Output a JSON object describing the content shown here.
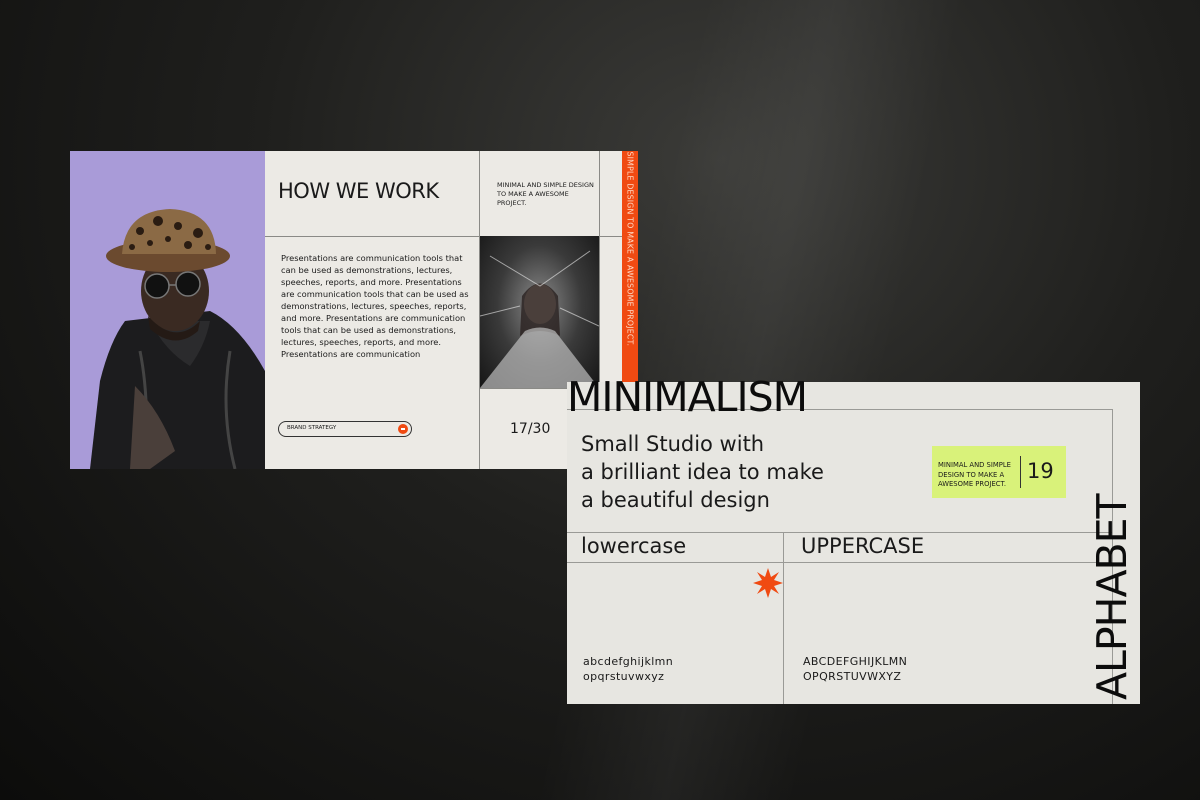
{
  "slide1": {
    "title": "HOW WE WORK",
    "tagline": "MINIMAL AND SIMPLE DESIGN TO MAKE A AWESOME PROJECT.",
    "paragraph": "Presentations are communication tools that can be used as demonstrations, lectures, speeches, reports, and more. Presentations are communication tools that can be used as demonstrations, lectures, speeches, reports, and more. Presentations are communication tools that can be used as demonstrations, lectures, speeches, reports, and more. Presentations are communication",
    "button_label": "BRAND STRATEGY",
    "page_number": "17/30",
    "vertical_text": "SIMPLE DESIGN TO MAKE A AWESOME PROJECT.",
    "accent_color": "#f04a12",
    "photo_bg_color": "#a99bd8"
  },
  "slide2": {
    "title": "MINIMALISM",
    "headline_lines": [
      "Small Studio with",
      "a brilliant idea to make",
      "a beautiful design"
    ],
    "badge_text": "MINIMAL AND SIMPLE DESIGN TO MAKE A AWESOME PROJECT.",
    "badge_number": "19",
    "badge_color": "#d9f27a",
    "lowercase_header": "lowercase",
    "uppercase_header": "UPPERCASE",
    "lowercase_lines": [
      "abcdefghijklmn",
      "opqrstuvwxyz"
    ],
    "uppercase_lines": [
      "ABCDEFGHIJKLMN",
      "OPQRSTUVWXYZ"
    ],
    "vertical_title": "ALPHABET",
    "star_icon": "starburst-icon"
  }
}
